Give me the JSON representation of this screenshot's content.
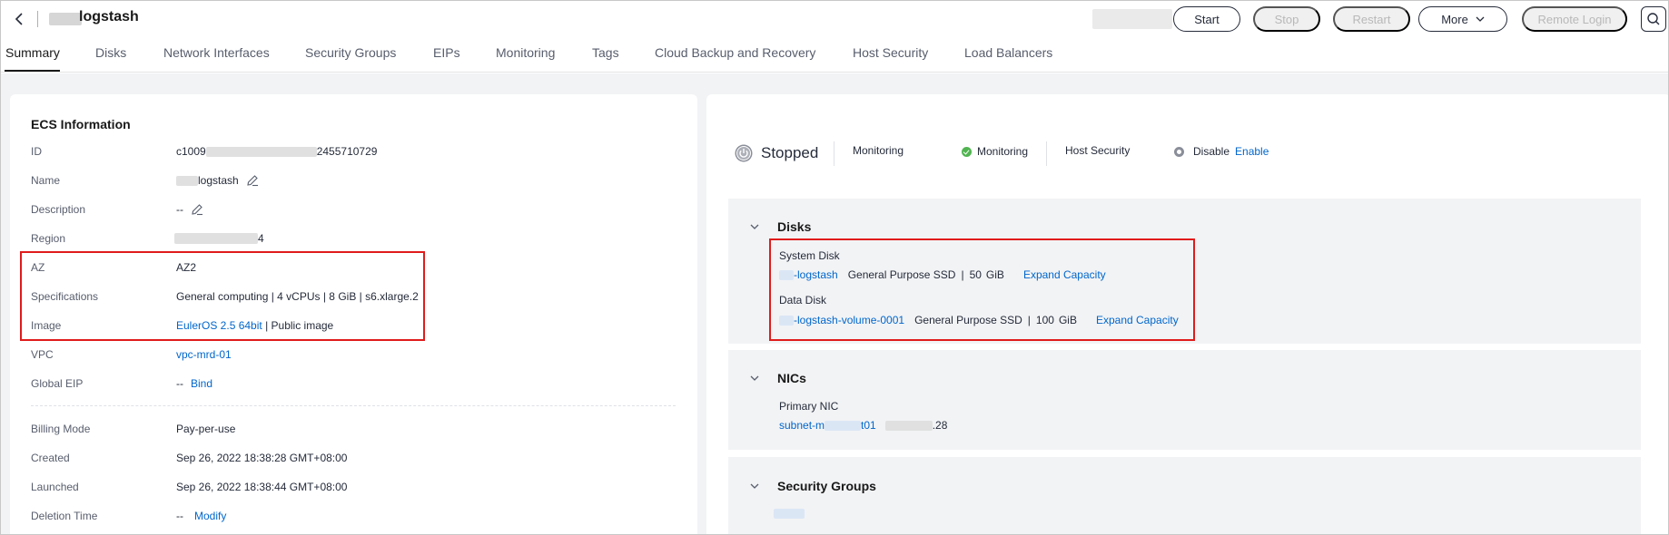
{
  "header": {
    "title": "logstash",
    "buttons": {
      "start": "Start",
      "stop": "Stop",
      "restart": "Restart",
      "more": "More",
      "remote_login": "Remote Login"
    }
  },
  "tabs": [
    {
      "label": "Summary",
      "active": true
    },
    {
      "label": "Disks"
    },
    {
      "label": "Network Interfaces"
    },
    {
      "label": "Security Groups"
    },
    {
      "label": "EIPs"
    },
    {
      "label": "Monitoring"
    },
    {
      "label": "Tags"
    },
    {
      "label": "Cloud Backup and Recovery"
    },
    {
      "label": "Host Security"
    },
    {
      "label": "Load Balancers"
    }
  ],
  "ecs_info": {
    "title": "ECS Information",
    "rows": {
      "id": {
        "label": "ID",
        "value_prefix": "c1009",
        "value_suffix": "2455710729"
      },
      "name": {
        "label": "Name",
        "value": "logstash"
      },
      "description": {
        "label": "Description",
        "value": "--"
      },
      "region": {
        "label": "Region",
        "value_suffix": "4"
      },
      "az": {
        "label": "AZ",
        "value": "AZ2"
      },
      "specifications": {
        "label": "Specifications",
        "value": "General computing | 4 vCPUs | 8 GiB | s6.xlarge.2"
      },
      "image": {
        "label": "Image",
        "link": "EulerOS 2.5 64bit",
        "suffix": " | Public image"
      },
      "vpc": {
        "label": "VPC",
        "link": "vpc-mrd-01"
      },
      "global_eip": {
        "label": "Global EIP",
        "value": "--",
        "link": "Bind"
      },
      "billing_mode": {
        "label": "Billing Mode",
        "value": "Pay-per-use"
      },
      "created": {
        "label": "Created",
        "value": "Sep 26, 2022 18:38:28 GMT+08:00"
      },
      "launched": {
        "label": "Launched",
        "value": "Sep 26, 2022 18:38:44 GMT+08:00"
      },
      "deletion_time": {
        "label": "Deletion Time",
        "value": "--",
        "link": "Modify"
      }
    }
  },
  "status": {
    "state": "Stopped",
    "monitoring_label": "Monitoring",
    "monitoring_value": "Monitoring",
    "host_security_label": "Host Security",
    "host_security_value": "Disable",
    "host_security_action": "Enable"
  },
  "disks": {
    "title": "Disks",
    "system_disk": {
      "label": "System Disk",
      "name": "-logstash",
      "type": "General Purpose SSD",
      "size": "50",
      "unit": "GiB",
      "action": "Expand Capacity"
    },
    "data_disk": {
      "label": "Data Disk",
      "name": "-logstash-volume-0001",
      "type": "General Purpose SSD",
      "size": "100",
      "unit": "GiB",
      "action": "Expand Capacity"
    }
  },
  "nics": {
    "title": "NICs",
    "primary_label": "Primary NIC",
    "subnet_prefix": "subnet-m",
    "subnet_suffix": "t01",
    "ip_suffix": ".28"
  },
  "security_groups": {
    "title": "Security Groups"
  },
  "colors": {
    "link": "#0066cc",
    "highlight_border": "#e01b1b",
    "status_green": "#50b450"
  }
}
